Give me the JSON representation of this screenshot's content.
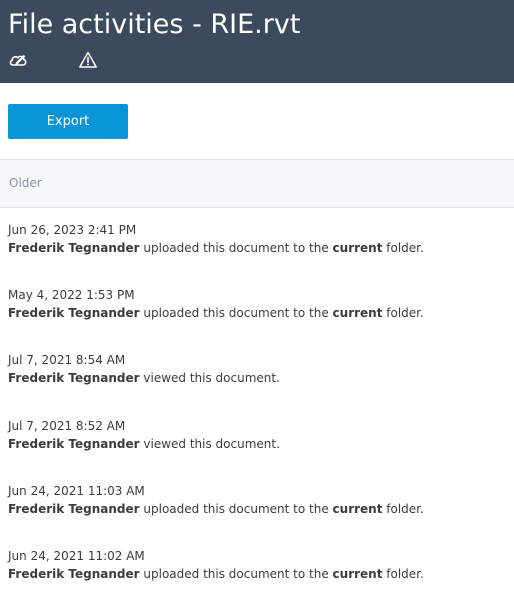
{
  "header": {
    "title": "File activities - RIE.rvt",
    "icons": [
      "edit-cloud-icon",
      "warning-icon"
    ]
  },
  "toolbar": {
    "export_label": "Export"
  },
  "section": {
    "label": "Older"
  },
  "activities": [
    {
      "time": "Jun 26, 2023 2:41 PM",
      "user": "Frederik Tegnander",
      "pre": "uploaded this document to the",
      "emph": "current",
      "post": "folder."
    },
    {
      "time": "May 4, 2022 1:53 PM",
      "user": "Frederik Tegnander",
      "pre": "uploaded this document to the",
      "emph": "current",
      "post": "folder."
    },
    {
      "time": "Jul 7, 2021 8:54 AM",
      "user": "Frederik Tegnander",
      "pre": "viewed this document.",
      "emph": "",
      "post": ""
    },
    {
      "time": "Jul 7, 2021 8:52 AM",
      "user": "Frederik Tegnander",
      "pre": "viewed this document.",
      "emph": "",
      "post": ""
    },
    {
      "time": "Jun 24, 2021 11:03 AM",
      "user": "Frederik Tegnander",
      "pre": "uploaded this document to the",
      "emph": "current",
      "post": "folder."
    },
    {
      "time": "Jun 24, 2021 11:02 AM",
      "user": "Frederik Tegnander",
      "pre": "uploaded this document to the",
      "emph": "current",
      "post": "folder."
    }
  ],
  "colors": {
    "header_bg": "#3c4a5e",
    "accent": "#0696d7",
    "section_bg": "#f6f7f8"
  }
}
